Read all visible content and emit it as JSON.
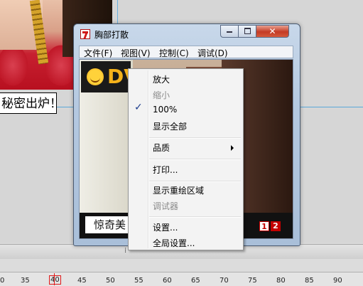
{
  "background": {
    "caption": "秘密出炉！"
  },
  "window": {
    "title": "胸部打散",
    "menubar": [
      "文件(F)",
      "视图(V)",
      "控制(C)",
      "调试(D)"
    ],
    "close_glyph": "✕",
    "logo_text": "DV",
    "caption": "惊奇美",
    "pages": [
      "1",
      "2"
    ]
  },
  "context_menu": {
    "items": [
      {
        "label": "放大",
        "enabled": true
      },
      {
        "label": "缩小",
        "enabled": false
      },
      {
        "label": "100%",
        "enabled": true,
        "checked": true
      },
      {
        "label": "显示全部",
        "enabled": true
      },
      {
        "label": "品质",
        "enabled": true,
        "submenu": true
      },
      {
        "label": "打印...",
        "enabled": true
      },
      {
        "label": "显示重绘区域",
        "enabled": true
      },
      {
        "label": "调试器",
        "enabled": false
      },
      {
        "label": "设置...",
        "enabled": true
      },
      {
        "label": "全局设置...",
        "enabled": true
      }
    ],
    "check_glyph": "✓"
  },
  "timeline": {
    "ruler_labels": [
      "0",
      "35",
      "40",
      "45",
      "50",
      "55",
      "60",
      "65",
      "70",
      "75",
      "80",
      "85",
      "90"
    ],
    "current_frame": "40"
  },
  "colors": {
    "accent_red": "#e01818",
    "title_bar": "#b4c8e0"
  }
}
